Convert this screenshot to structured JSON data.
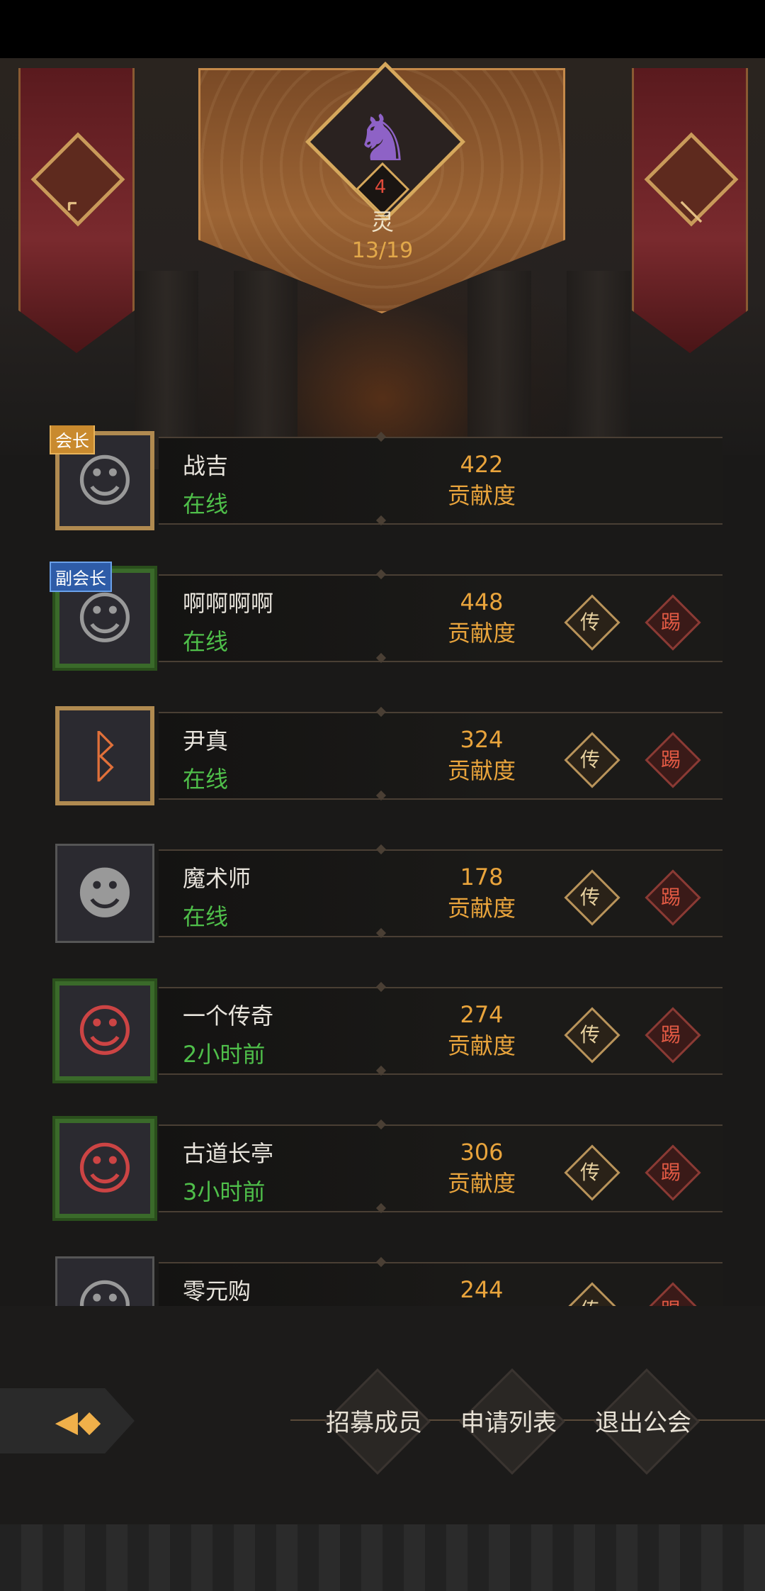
{
  "guild": {
    "level": "4",
    "name": "灵",
    "members": "13/19"
  },
  "score_label": "贡献度",
  "members": [
    {
      "name": "战吉",
      "status": "在线",
      "score": "422",
      "role": "会长",
      "show_actions": false
    },
    {
      "name": "啊啊啊啊",
      "status": "在线",
      "score": "448",
      "role": "副会长",
      "show_actions": true
    },
    {
      "name": "尹真",
      "status": "在线",
      "score": "324",
      "role": "",
      "show_actions": true
    },
    {
      "name": "魔术师",
      "status": "在线",
      "score": "178",
      "role": "",
      "show_actions": true
    },
    {
      "name": "一个传奇",
      "status": "2小时前",
      "score": "274",
      "role": "",
      "show_actions": true
    },
    {
      "name": "古道长亭",
      "status": "3小时前",
      "score": "306",
      "role": "",
      "show_actions": true
    },
    {
      "name": "零元购",
      "status": "",
      "score": "244",
      "role": "",
      "show_actions": true
    }
  ],
  "actions": {
    "transfer": "传",
    "kick": "踢"
  },
  "bottom": {
    "recruit": "招募成员",
    "applications": "申请列表",
    "leave": "退出公会"
  }
}
